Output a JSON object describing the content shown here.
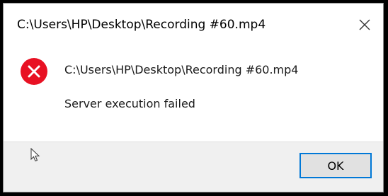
{
  "window": {
    "title": "C:\\Users\\HP\\Desktop\\Recording #60.mp4",
    "close_icon": "close-icon"
  },
  "content": {
    "icon": "error-icon",
    "icon_color": "#e81123",
    "path": "C:\\Users\\HP\\Desktop\\Recording #60.mp4",
    "message": "Server execution failed"
  },
  "footer": {
    "ok_label": "OK",
    "accent": "#0078d7"
  }
}
